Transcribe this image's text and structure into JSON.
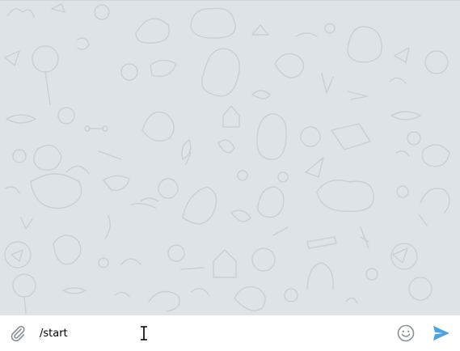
{
  "composer": {
    "message_value": "/start",
    "placeholder": "",
    "attach_icon": "paperclip-icon",
    "emoji_icon": "smile-icon",
    "send_icon": "send-arrow-icon"
  },
  "colors": {
    "chat_background": "#dde3e7",
    "pattern_stroke": "#c7ced4",
    "icon_gray": "#8a9299",
    "send_accent": "#4aa3e0"
  }
}
